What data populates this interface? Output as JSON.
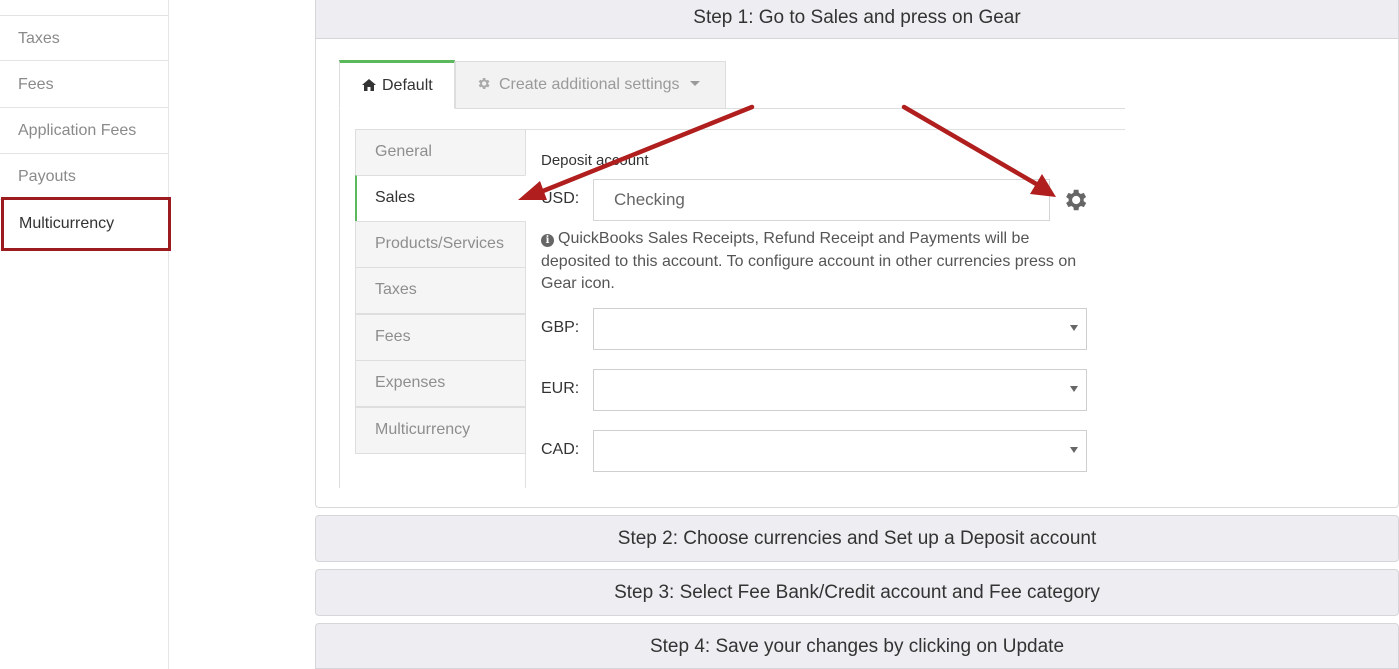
{
  "sidebar": {
    "items": [
      {
        "label": "Taxes"
      },
      {
        "label": "Fees"
      },
      {
        "label": "Application Fees"
      },
      {
        "label": "Payouts"
      },
      {
        "label": "Multicurrency"
      }
    ],
    "active_index": 4,
    "highlight_color": "#9b1b1f"
  },
  "steps": {
    "step1": "Step 1: Go to Sales and press on Gear",
    "step2": "Step 2: Choose currencies and Set up a Deposit account",
    "step3": "Step 3: Select Fee Bank/Credit account and Fee category",
    "step4": "Step 4: Save your changes by clicking on Update"
  },
  "screenshot": {
    "tabs": {
      "default_label": "Default",
      "default_icon": "home-icon",
      "create_label": "Create additional settings",
      "create_icon": "gear-icon"
    },
    "vnav": [
      {
        "label": "General"
      },
      {
        "label": "Sales"
      },
      {
        "label": "Products/Services"
      },
      {
        "label": "Taxes"
      },
      {
        "label": "Fees"
      },
      {
        "label": "Expenses"
      },
      {
        "label": "Multicurrency"
      }
    ],
    "vnav_active_index": 1,
    "deposit_label": "Deposit account",
    "usd": {
      "label": "USD:",
      "value": "Checking"
    },
    "info_text": "QuickBooks Sales Receipts, Refund Receipt and Payments will be deposited to this account. To configure account in other currencies press on Gear icon.",
    "currencies": [
      {
        "label": "GBP:",
        "value": ""
      },
      {
        "label": "EUR:",
        "value": ""
      },
      {
        "label": "CAD:",
        "value": ""
      }
    ],
    "accent_green": "#5cb85c",
    "arrow_color": "#b01e1e"
  }
}
